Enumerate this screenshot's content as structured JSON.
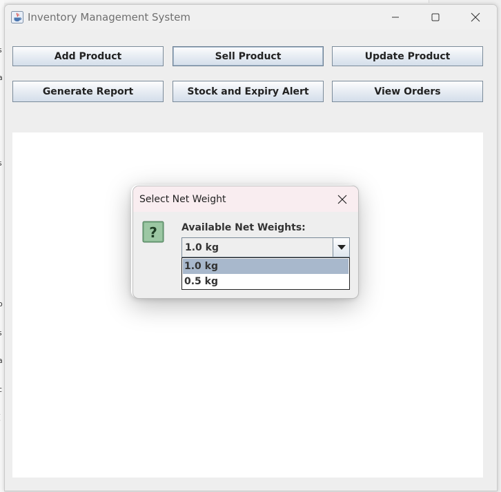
{
  "window": {
    "title": "Inventory Management System"
  },
  "toolbar": {
    "buttons": [
      {
        "label": "Add Product"
      },
      {
        "label": "Sell Product"
      },
      {
        "label": "Update Product"
      },
      {
        "label": "Generate Report"
      },
      {
        "label": "Stock and Expiry Alert"
      },
      {
        "label": "View Orders"
      }
    ]
  },
  "dialog": {
    "title": "Select Net Weight",
    "label": "Available Net Weights:",
    "combo_value": "1.0 kg",
    "options": [
      {
        "label": "1.0 kg",
        "selected": true
      },
      {
        "label": "0.5 kg",
        "selected": false
      }
    ]
  },
  "background_glyphs": [
    "s",
    "a",
    "s",
    "o",
    "s",
    "a",
    "c",
    "["
  ],
  "colors": {
    "selected_option": "#a8b8cc",
    "dialog_titlebar": "#f9edf0",
    "content_bg": "#ffffff"
  }
}
